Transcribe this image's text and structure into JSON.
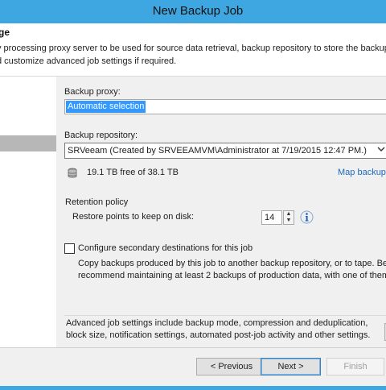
{
  "window": {
    "title": "New Backup Job"
  },
  "header": {
    "title": "ge",
    "description": "y processing proxy server to be used for source data retrieval, backup repository to store the backup fil\nd customize advanced job settings if required."
  },
  "proxy": {
    "label": "Backup proxy:",
    "value": "Automatic selection"
  },
  "repository": {
    "label": "Backup repository:",
    "selected": "SRVeeam (Created by SRVEEAMVM\\Administrator at 7/19/2015 12:47 PM.)",
    "capacity_text": "19.1 TB free of 38.1 TB",
    "map_link": "Map backup"
  },
  "retention": {
    "group_label": "Retention policy",
    "restore_points_label": "Restore points to keep on disk:",
    "restore_points_value": "14"
  },
  "secondary": {
    "checkbox_label": "Configure secondary destinations for this job",
    "checked": false,
    "description": "Copy backups produced by this job to another backup repository, or to tape. Best\nrecommend maintaining at least 2 backups of production data, with one of them b"
  },
  "advanced": {
    "description": "Advanced job settings include backup mode, compression and deduplication,\nblock size, notification settings, automated post-job activity and other settings."
  },
  "buttons": {
    "previous": "< Previous",
    "next": "Next >",
    "finish": "Finish"
  },
  "icons": {
    "database": "database-icon",
    "info": "info-icon",
    "chevron": "chevron-down-icon",
    "spin_up": "spin-up-icon",
    "spin_down": "spin-down-icon"
  },
  "colors": {
    "titlebar": "#3ea6e0",
    "selection": "#3399ff",
    "link": "#1b6bbf",
    "nav_selected": "#b7b7b7"
  }
}
